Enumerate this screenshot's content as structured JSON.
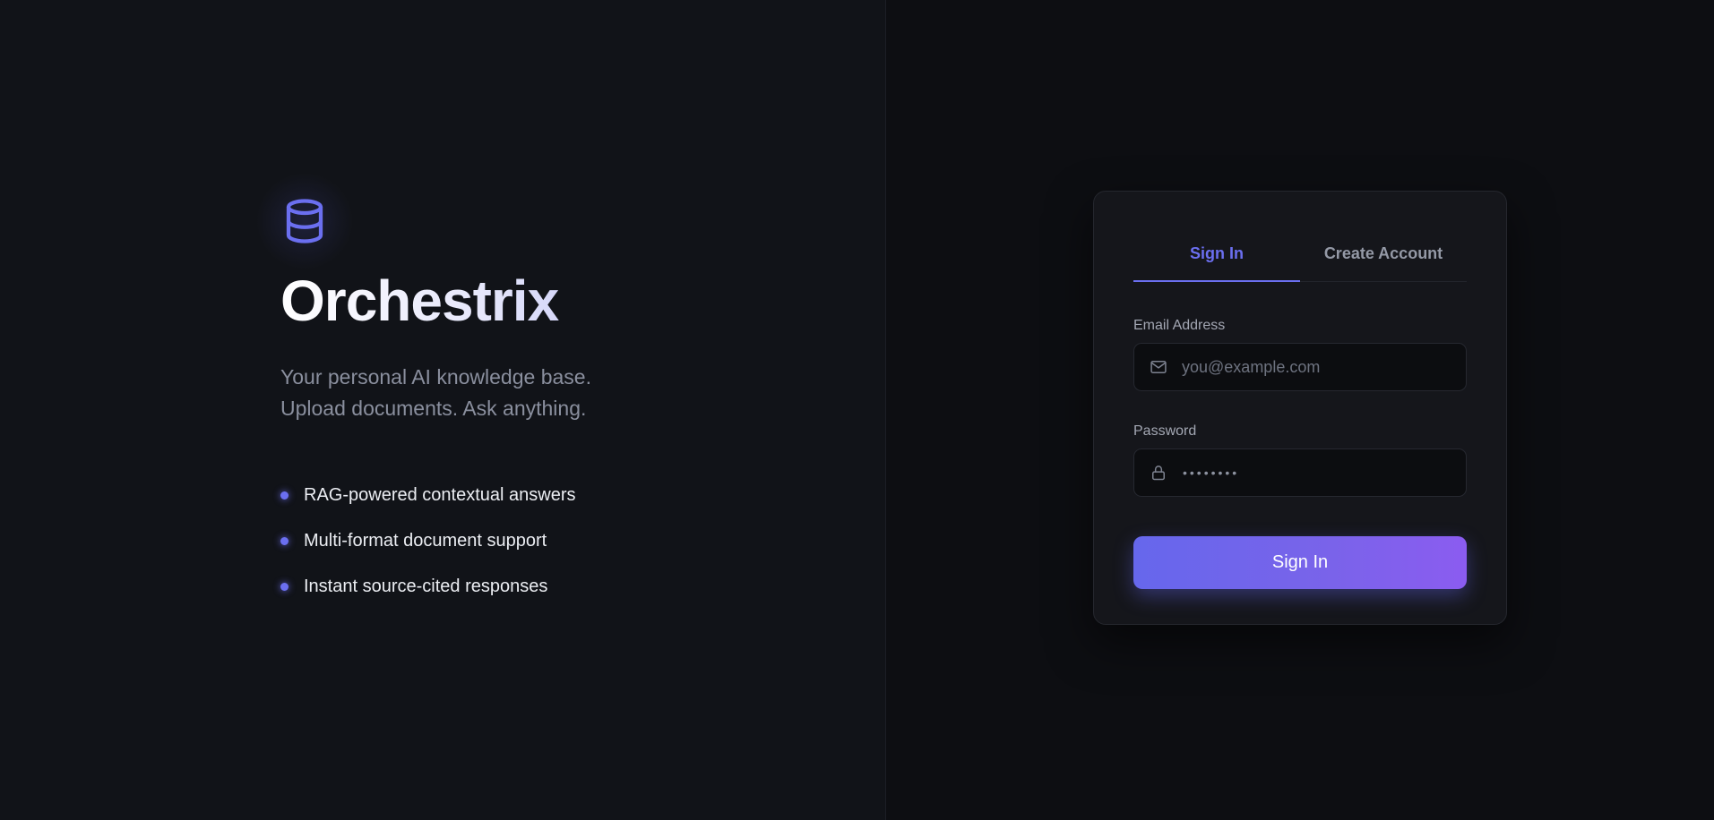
{
  "hero": {
    "logo_icon": "database-icon",
    "title": "Orchestrix",
    "tagline_line1": "Your personal AI knowledge base.",
    "tagline_line2": "Upload documents. Ask anything.",
    "features": [
      "RAG-powered contextual answers",
      "Multi-format document support",
      "Instant source-cited responses"
    ]
  },
  "auth": {
    "tabs": [
      {
        "label": "Sign In",
        "active": true
      },
      {
        "label": "Create Account",
        "active": false
      }
    ],
    "email": {
      "label": "Email Address",
      "placeholder": "you@example.com",
      "value": "",
      "icon": "mail-icon"
    },
    "password": {
      "label": "Password",
      "masked_value": "••••••••",
      "icon": "lock-icon"
    },
    "submit_label": "Sign In"
  },
  "colors": {
    "accent": "#6b6ff0",
    "button_gradient_start": "#6667ec",
    "button_gradient_end": "#8b5cf0",
    "background": "#0d0e12",
    "hero_background": "#111318",
    "card_background": "#15161b"
  }
}
